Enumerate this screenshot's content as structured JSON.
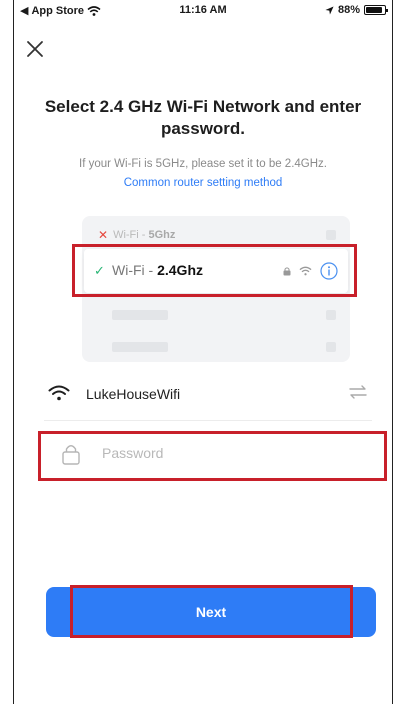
{
  "status_bar": {
    "back_app": "App Store",
    "time": "11:16 AM",
    "battery": "88%",
    "battery_level": 0.88
  },
  "header": {
    "title": "Select 2.4 GHz Wi-Fi Network and enter password."
  },
  "hint": {
    "text": "If your Wi-Fi is 5GHz, please set it to be 2.4GHz.",
    "link": "Common router setting method"
  },
  "illustration": {
    "wifi_5g_prefix": "Wi-Fi - ",
    "wifi_5g_band": "5Ghz",
    "wifi_24_prefix": "Wi-Fi - ",
    "wifi_24_band": "2.4Ghz"
  },
  "form": {
    "ssid": "LukeHouseWifi",
    "password_placeholder": "Password",
    "password_value": ""
  },
  "actions": {
    "next_label": "Next"
  },
  "colors": {
    "accent": "#2e7cf6",
    "highlight": "#c8202a",
    "check": "#2ab676",
    "error_x": "#e5473d"
  }
}
